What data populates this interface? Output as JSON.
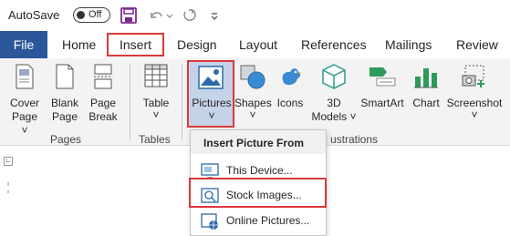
{
  "titlebar": {
    "autosave_label": "AutoSave",
    "toggle_state": "Off"
  },
  "tabs": {
    "file": "File",
    "home": "Home",
    "insert": "Insert",
    "design": "Design",
    "layout": "Layout",
    "references": "References",
    "mailings": "Mailings",
    "review": "Review"
  },
  "ribbon": {
    "pages": {
      "cover_page_1": "Cover",
      "cover_page_2": "Page",
      "blank_page_1": "Blank",
      "blank_page_2": "Page",
      "page_break_1": "Page",
      "page_break_2": "Break",
      "group_label": "Pages"
    },
    "tables": {
      "table": "Table",
      "group_label": "Tables"
    },
    "illustrations": {
      "pictures": "Pictures",
      "shapes": "Shapes",
      "icons": "Icons",
      "models_1": "3D",
      "models_2": "Models",
      "smartart": "SmartArt",
      "chart": "Chart",
      "screenshot": "Screenshot",
      "group_label_partial": "ustrations"
    }
  },
  "dropdown": {
    "header": "Insert Picture From",
    "items": [
      "This Device...",
      "Stock Images...",
      "Online Pictures..."
    ]
  },
  "colors": {
    "file_tab": "#2b579a",
    "highlight_box": "#d9393b",
    "pictures_selected": "#c5d3e8"
  }
}
